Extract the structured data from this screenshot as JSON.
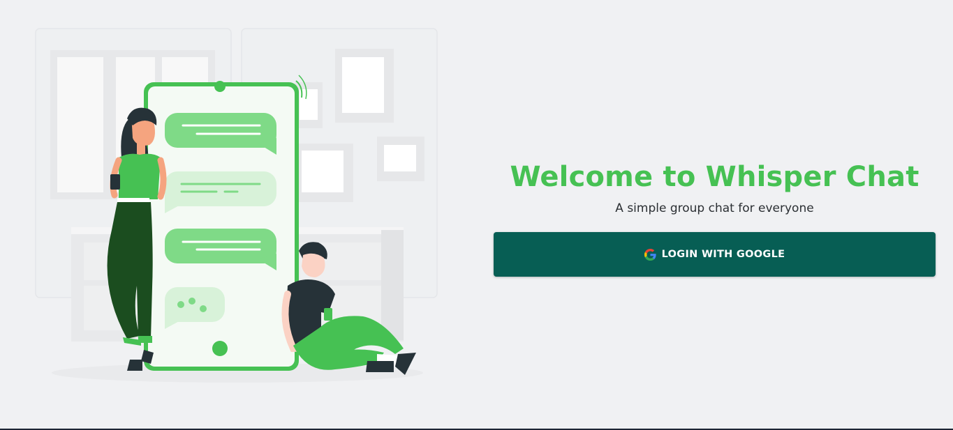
{
  "hero": {
    "title": "Welcome to Whisper Chat",
    "subtitle": "A simple group chat for everyone"
  },
  "login": {
    "label": "LOGIN WITH GOOGLE",
    "icon": "google-icon"
  },
  "colors": {
    "accent": "#46c153",
    "button": "#075e54",
    "background": "#f0f1f3"
  }
}
